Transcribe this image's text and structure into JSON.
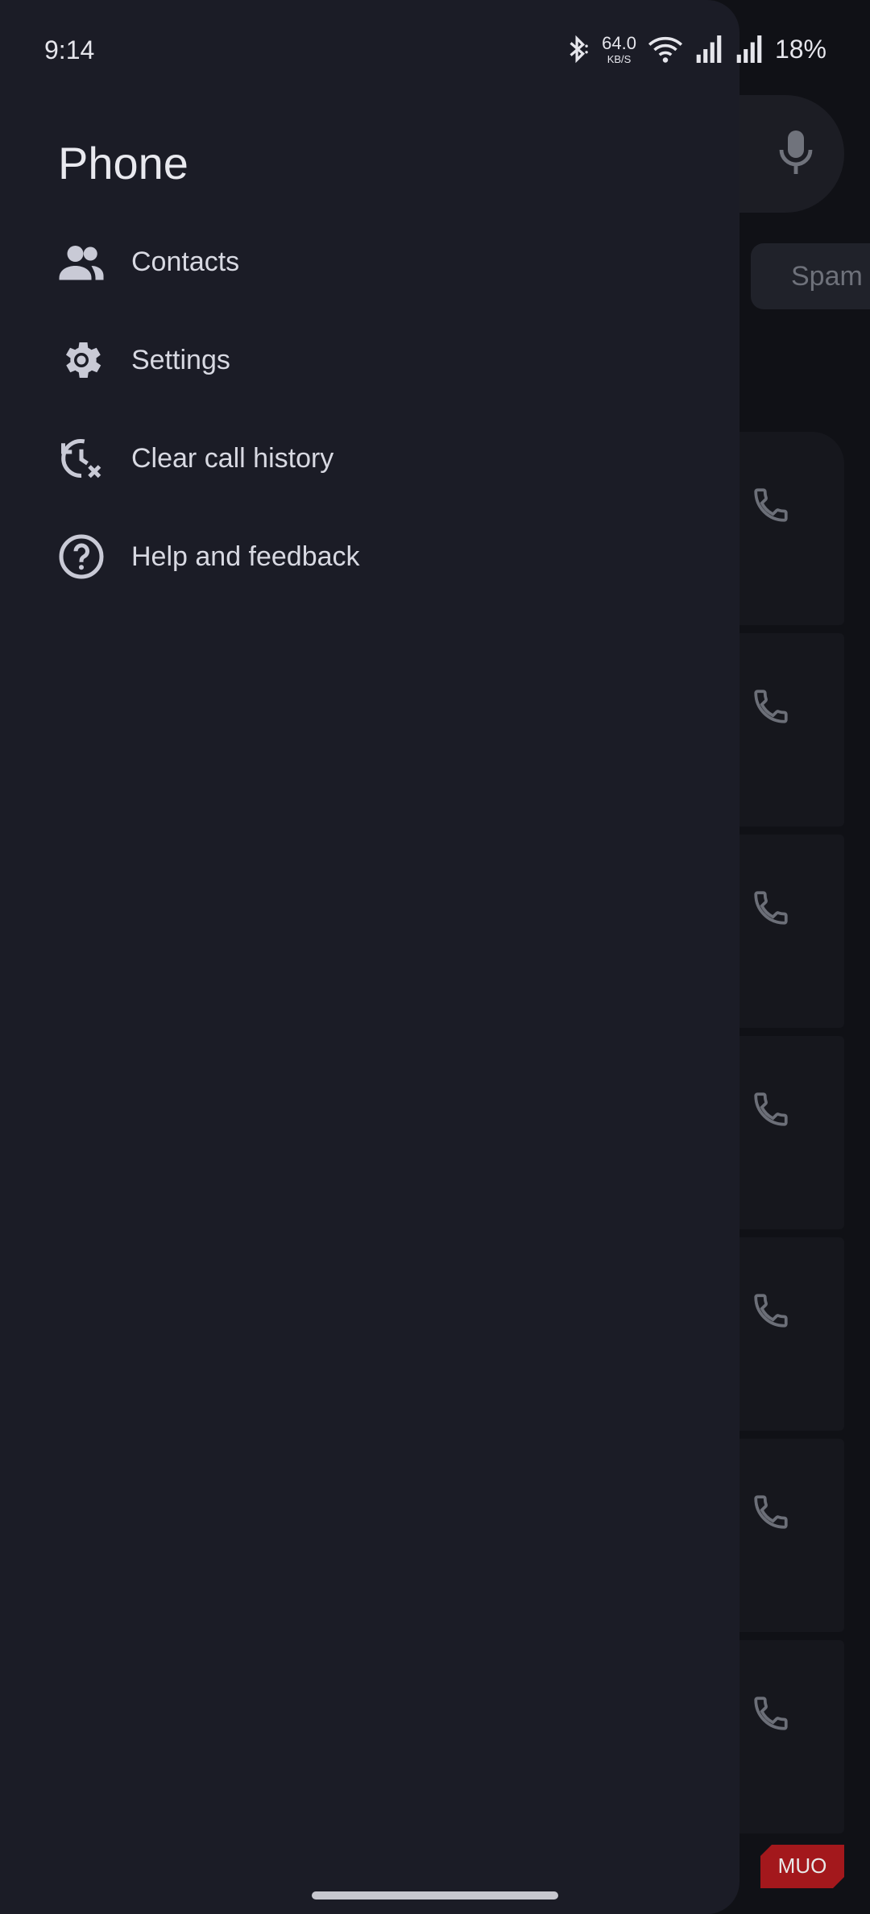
{
  "status_bar": {
    "time": "9:14",
    "net_speed_value": "64.0",
    "net_speed_unit": "KB/S",
    "battery": "18%",
    "icons": [
      "bluetooth-icon",
      "wifi-icon",
      "signal-icon",
      "signal-icon"
    ]
  },
  "drawer": {
    "title": "Phone",
    "items": [
      {
        "label": "Contacts",
        "icon": "contacts-icon"
      },
      {
        "label": "Settings",
        "icon": "gear-icon"
      },
      {
        "label": "Clear call history",
        "icon": "history-clear-icon"
      },
      {
        "label": "Help and feedback",
        "icon": "help-icon"
      }
    ]
  },
  "background": {
    "chip_label": "Spam",
    "rows": 7
  },
  "watermark": {
    "text": "MUO"
  },
  "colors": {
    "drawer_bg": "#1b1c26",
    "page_bg": "#101116",
    "text": "#d8d9e2",
    "watermark": "#a3181c"
  }
}
